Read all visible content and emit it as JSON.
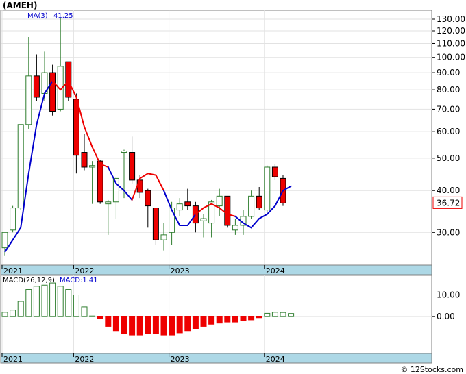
{
  "chart_data": [
    {
      "type": "candlestick",
      "symbol_label": "(AMEH)",
      "ma_label": "MA(3)",
      "ma_value": "41.25",
      "last_price_label": "36.72",
      "y_scale": "log",
      "ylim": [
        25,
        135
      ],
      "grid": true,
      "y_ticks": [
        "130.00",
        "120.00",
        "110.00",
        "100.00",
        "90.00",
        "80.00",
        "70.00",
        "60.00",
        "50.00",
        "40.00",
        "30.00"
      ],
      "x_labels": [
        "2021",
        "2022",
        "2023",
        "2024"
      ],
      "candles": [
        {
          "o": 27.0,
          "h": 30.0,
          "l": 25.5,
          "c": 30.0
        },
        {
          "o": 30.5,
          "h": 36.0,
          "l": 30.0,
          "c": 35.5
        },
        {
          "o": 35.5,
          "h": 63.0,
          "l": 35.0,
          "c": 63.0
        },
        {
          "o": 63.0,
          "h": 115.0,
          "l": 61.0,
          "c": 88.0
        },
        {
          "o": 88.0,
          "h": 102.0,
          "l": 74.0,
          "c": 76.0
        },
        {
          "o": 78.0,
          "h": 104.0,
          "l": 74.0,
          "c": 90.0
        },
        {
          "o": 90.0,
          "h": 95.0,
          "l": 67.0,
          "c": 69.0
        },
        {
          "o": 70.0,
          "h": 131.0,
          "l": 69.0,
          "c": 94.0
        },
        {
          "o": 97.0,
          "h": 97.0,
          "l": 74.0,
          "c": 76.0
        },
        {
          "o": 75.0,
          "h": 78.0,
          "l": 45.0,
          "c": 51.0
        },
        {
          "o": 52.0,
          "h": 59.0,
          "l": 46.0,
          "c": 47.0
        },
        {
          "o": 47.0,
          "h": 49.0,
          "l": 36.5,
          "c": 47.5
        },
        {
          "o": 49.0,
          "h": 49.5,
          "l": 36.5,
          "c": 37.0
        },
        {
          "o": 36.5,
          "h": 37.5,
          "l": 29.5,
          "c": 37.0
        },
        {
          "o": 37.0,
          "h": 44.0,
          "l": 33.0,
          "c": 43.5
        },
        {
          "o": 52.0,
          "h": 53.0,
          "l": 38.0,
          "c": 52.5
        },
        {
          "o": 52.0,
          "h": 58.0,
          "l": 42.0,
          "c": 43.0
        },
        {
          "o": 43.0,
          "h": 44.5,
          "l": 38.0,
          "c": 39.5
        },
        {
          "o": 40.0,
          "h": 40.5,
          "l": 31.0,
          "c": 36.0
        },
        {
          "o": 35.5,
          "h": 35.5,
          "l": 27.5,
          "c": 28.5
        },
        {
          "o": 28.5,
          "h": 32.0,
          "l": 26.5,
          "c": 29.5
        },
        {
          "o": 30.0,
          "h": 37.0,
          "l": 27.5,
          "c": 35.5
        },
        {
          "o": 35.0,
          "h": 38.0,
          "l": 33.5,
          "c": 36.5
        },
        {
          "o": 37.0,
          "h": 40.5,
          "l": 35.0,
          "c": 36.0
        },
        {
          "o": 36.0,
          "h": 37.0,
          "l": 30.0,
          "c": 32.0
        },
        {
          "o": 32.5,
          "h": 34.0,
          "l": 29.0,
          "c": 33.0
        },
        {
          "o": 32.0,
          "h": 37.5,
          "l": 29.0,
          "c": 37.0
        },
        {
          "o": 36.0,
          "h": 40.5,
          "l": 33.5,
          "c": 38.5
        },
        {
          "o": 38.5,
          "h": 38.5,
          "l": 31.0,
          "c": 31.5
        },
        {
          "o": 30.5,
          "h": 33.0,
          "l": 29.5,
          "c": 31.5
        },
        {
          "o": 31.5,
          "h": 35.0,
          "l": 29.5,
          "c": 33.5
        },
        {
          "o": 33.5,
          "h": 40.0,
          "l": 33.0,
          "c": 38.5
        },
        {
          "o": 38.5,
          "h": 41.0,
          "l": 35.0,
          "c": 35.5
        },
        {
          "o": 35.0,
          "h": 47.5,
          "l": 34.5,
          "c": 47.0
        },
        {
          "o": 47.0,
          "h": 48.0,
          "l": 43.0,
          "c": 44.0
        },
        {
          "o": 43.5,
          "h": 44.5,
          "l": 36.0,
          "c": 36.72
        }
      ],
      "ma_line": [
        null,
        null,
        31.0,
        45.0,
        63.0,
        78.0,
        85.0,
        80.0,
        85.0,
        76.0,
        62.0,
        54.0,
        48.0,
        47.0,
        42.0,
        40.0,
        37.5,
        43.5,
        45.0,
        44.5,
        40.0,
        35.0,
        31.5,
        31.5,
        34.0,
        35.5,
        36.5,
        35.5,
        34.0,
        33.5,
        32.0,
        31.0,
        33.0,
        34.0,
        36.0,
        40.0,
        41.25
      ],
      "ma_colors": [
        "#000000",
        "#000000",
        "#0000cc",
        "#0000cc",
        "#0000cc",
        "#0000cc",
        "#0000cc",
        "#ee0000",
        "#ee0000",
        "#ee0000",
        "#ee0000",
        "#ee0000",
        "#ee0000",
        "#ee0000",
        "#0000cc",
        "#0000cc",
        "#0000cc",
        "#ee0000",
        "#ee0000",
        "#ee0000",
        "#ee0000",
        "#0000cc",
        "#0000cc",
        "#0000cc",
        "#0000cc",
        "#ee0000",
        "#ee0000",
        "#ee0000",
        "#ee0000",
        "#ee0000",
        "#0000cc",
        "#0000cc",
        "#0000cc",
        "#0000cc",
        "#0000cc",
        "#0000cc",
        "#0000cc"
      ]
    },
    {
      "type": "bar",
      "label": "MACD(26,12,9)",
      "value_label": "MACD:1.41",
      "ylim": [
        -17,
        19
      ],
      "y_ticks": [
        "10.00",
        "0.00"
      ],
      "x_labels": [
        "2021",
        "2022",
        "2023",
        "2024"
      ],
      "values": [
        2.0,
        3.0,
        7.0,
        12.5,
        14.0,
        14.5,
        15.5,
        14.0,
        12.5,
        10.0,
        4.5,
        0.3,
        -1.0,
        -4.5,
        -6.5,
        -8.0,
        -8.5,
        -8.5,
        -8.0,
        -8.0,
        -8.5,
        -8.5,
        -7.5,
        -6.5,
        -5.5,
        -4.5,
        -3.5,
        -3.0,
        -2.5,
        -2.5,
        -2.0,
        -1.5,
        -0.5,
        1.5,
        2.0,
        1.9,
        1.41
      ]
    }
  ],
  "colors": {
    "up": "#ffffff",
    "down": "#ee0000",
    "wick_up": "#2e7d2e",
    "macd_pos": "#ffffff",
    "macd_neg": "#ee0000",
    "ma_up": "#0000cc",
    "ma_down": "#ee0000",
    "axis_band": "#add8e6"
  },
  "footer": "© 12Stocks.com"
}
